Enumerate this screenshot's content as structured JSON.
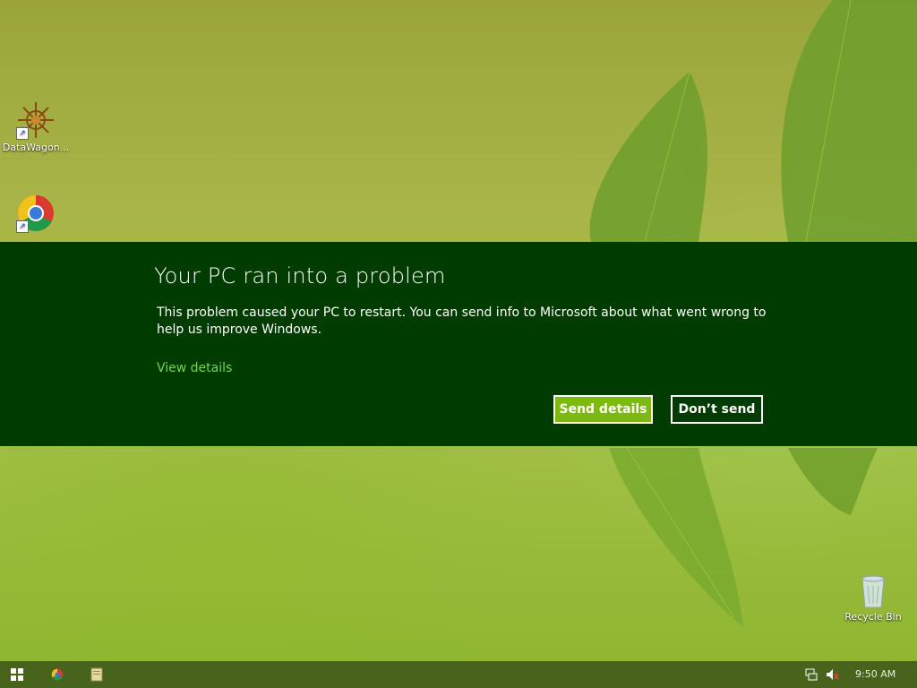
{
  "desktop": {
    "icons": [
      {
        "label": "DataWagon..."
      },
      {
        "label": ""
      },
      {
        "label": "Recycle Bin"
      }
    ]
  },
  "dialog": {
    "title": "Your PC ran into a problem",
    "message": "This problem caused your PC to restart. You can send info to Microsoft about what went wrong to help us improve Windows.",
    "view_details_link": "View details",
    "send_button": "Send details",
    "dont_send_button": "Don’t send",
    "colors": {
      "background": "#003c00",
      "accent": "#7dba0f",
      "link": "#6fd64a"
    }
  },
  "taskbar": {
    "items": [
      "start-icon",
      "chrome-icon",
      "file-explorer-icon"
    ],
    "tray_icons": [
      "network-icon",
      "volume-muted-icon"
    ],
    "clock": "9:50 AM"
  }
}
